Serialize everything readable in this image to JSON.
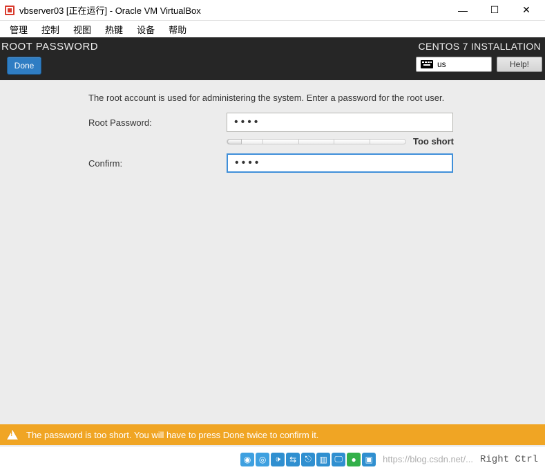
{
  "window": {
    "title": "vbserver03 [正在运行] - Oracle VM VirtualBox",
    "controls": {
      "minimize": "—",
      "maximize": "☐",
      "close": "✕"
    }
  },
  "menubar": {
    "items": [
      "管理",
      "控制",
      "视图",
      "热键",
      "设备",
      "帮助"
    ]
  },
  "installer": {
    "title": "ROOT PASSWORD",
    "subtitle": "CENTOS 7 INSTALLATION",
    "done_label": "Done",
    "keyboard_layout": "us",
    "help_label": "Help!"
  },
  "form": {
    "description": "The root account is used for administering the system.  Enter a password for the root user.",
    "root_label": "Root Password:",
    "root_value": "••••",
    "confirm_label": "Confirm:",
    "confirm_value": "••••",
    "strength_text": "Too short"
  },
  "warning": {
    "text": "The password is too short. You will have to press Done twice to confirm it."
  },
  "statusbar": {
    "watermark": "https://blog.csdn.net/...",
    "hostkey": "Right Ctrl",
    "icons": [
      {
        "name": "disk",
        "bg": "#3ea0e0",
        "glyph": "◉"
      },
      {
        "name": "optical",
        "bg": "#3ea0e0",
        "glyph": "◎"
      },
      {
        "name": "audio",
        "bg": "#2f8fd0",
        "glyph": "🕩"
      },
      {
        "name": "network",
        "bg": "#2f8fd0",
        "glyph": "⇆"
      },
      {
        "name": "usb",
        "bg": "#2f8fd0",
        "glyph": "⎋"
      },
      {
        "name": "shared",
        "bg": "#2f8fd0",
        "glyph": "▥"
      },
      {
        "name": "display",
        "bg": "#2f8fd0",
        "glyph": "🖵"
      },
      {
        "name": "recording",
        "bg": "#33b04a",
        "glyph": "●"
      },
      {
        "name": "cpu",
        "bg": "#2f8fd0",
        "glyph": "▣"
      }
    ]
  }
}
